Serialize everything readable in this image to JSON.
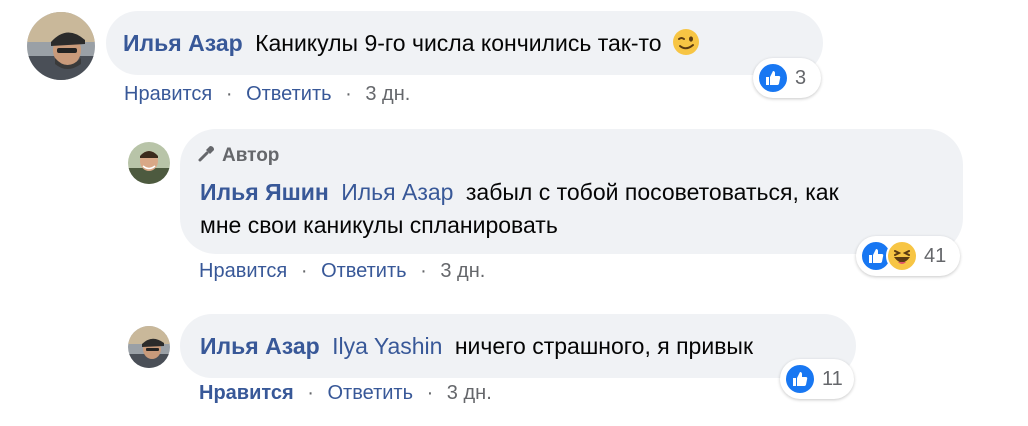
{
  "comments": [
    {
      "author": "Илья Азар",
      "text": "Каникулы 9-го числа кончились так-то",
      "emoji": "wink-emoji",
      "actions": {
        "like": "Нравится",
        "reply": "Ответить",
        "sep": "·",
        "time": "3 дн."
      },
      "reactions": {
        "icons": [
          "like-icon"
        ],
        "count": "3"
      }
    },
    {
      "badge": "Автор",
      "author": "Илья Яшин",
      "mention": "Илья Азар",
      "text_line1": "забыл с тобой посоветоваться, как",
      "text_line2": "мне свои каникулы спланировать",
      "actions": {
        "like": "Нравится",
        "reply": "Ответить",
        "sep": "·",
        "time": "3 дн."
      },
      "reactions": {
        "icons": [
          "like-icon",
          "haha-icon"
        ],
        "count": "41"
      }
    },
    {
      "author": "Илья Азар",
      "mention": "Ilya Yashin",
      "text": "ничего страшного, я привык",
      "actions": {
        "like": "Нравится",
        "reply": "Ответить",
        "sep": "·",
        "time": "3 дн."
      },
      "reactions": {
        "icons": [
          "like-icon"
        ],
        "count": "11"
      }
    }
  ],
  "colors": {
    "link": "#385898",
    "bubble": "#f0f2f5",
    "meta": "#65676b",
    "like": "#1877f2"
  }
}
